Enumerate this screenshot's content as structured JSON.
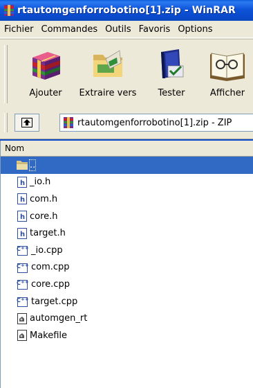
{
  "window": {
    "title": "rtautomgenforrobotino[1].zip - WinRAR"
  },
  "menu": [
    "Fichier",
    "Commandes",
    "Outils",
    "Favoris",
    "Options"
  ],
  "toolbar": {
    "add_label": "Ajouter",
    "extract_label": "Extraire vers",
    "test_label": "Tester",
    "view_label": "Afficher"
  },
  "address": {
    "path": "rtautomgenforrobotino[1].zip - ZIP"
  },
  "filelist": {
    "column_name": "Nom",
    "files": [
      {
        "name": "..",
        "icon": "folder-up-icon",
        "selected": true
      },
      {
        "name": "_io.h",
        "icon": "h-file-icon"
      },
      {
        "name": "com.h",
        "icon": "h-file-icon"
      },
      {
        "name": "core.h",
        "icon": "h-file-icon"
      },
      {
        "name": "target.h",
        "icon": "h-file-icon"
      },
      {
        "name": "_io.cpp",
        "icon": "cpp-file-icon"
      },
      {
        "name": "com.cpp",
        "icon": "cpp-file-icon"
      },
      {
        "name": "core.cpp",
        "icon": "cpp-file-icon"
      },
      {
        "name": "target.cpp",
        "icon": "cpp-file-icon"
      },
      {
        "name": "automgen_rt",
        "icon": "generic-file-icon"
      },
      {
        "name": "Makefile",
        "icon": "generic-file-icon"
      }
    ]
  },
  "colors": {
    "titlebar": "#0A4ACB",
    "selection": "#316AC5"
  }
}
